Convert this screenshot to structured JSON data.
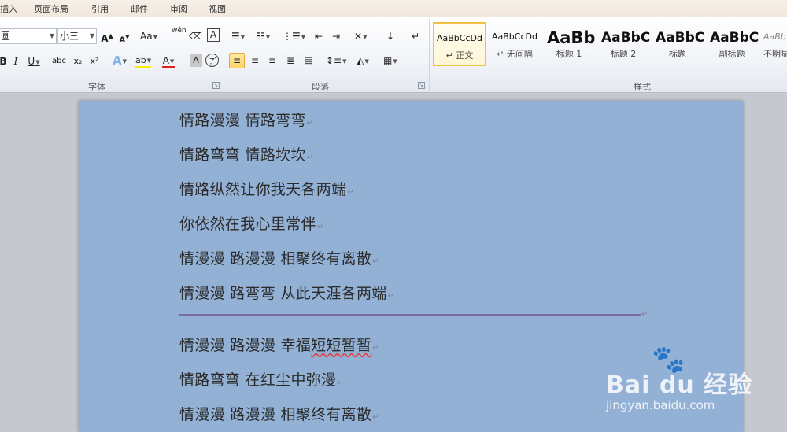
{
  "menu": {
    "tabs": [
      "插入",
      "页面布局",
      "引用",
      "邮件",
      "审阅",
      "视图"
    ]
  },
  "ribbon": {
    "font": {
      "font_name": "圆",
      "font_size": "小三",
      "grow_label": "A",
      "shrink_label": "A",
      "change_case": "Aa",
      "phonetic": "wén",
      "char_border": "A",
      "enclose": "字",
      "italic": "I",
      "underline": "U",
      "strike": "abc",
      "subscript": "x₂",
      "superscript": "x²",
      "text_effects": "A",
      "highlight": "ab",
      "font_color": "A",
      "shading": "A",
      "group_label": "字体"
    },
    "paragraph": {
      "group_label": "段落"
    },
    "styles": {
      "group_label": "样式",
      "items": [
        {
          "sample": "AaBbCcDd",
          "name": "↵ 正文"
        },
        {
          "sample": "AaBbCcDd",
          "name": "↵ 无间隔"
        },
        {
          "sample": "AaBb",
          "name": "标题 1"
        },
        {
          "sample": "AaBbC",
          "name": "标题 2"
        },
        {
          "sample": "AaBbC",
          "name": "标题"
        },
        {
          "sample": "AaBbC",
          "name": "副标题"
        },
        {
          "sample": "AaBb",
          "name": "不明显"
        }
      ]
    }
  },
  "document": {
    "lines_top": [
      "情路漫漫  情路弯弯",
      "情路弯弯  情路坎坎",
      "情路纵然让你我天各两端",
      "你依然在我心里常伴",
      "情漫漫  路漫漫  相聚终有离散",
      "情漫漫  路弯弯  从此天涯各两端"
    ],
    "line7_before": "情漫漫  路漫漫  幸福",
    "line7_marked": "短短暂暂",
    "lines_bottom": [
      "情路弯弯  在红尘中弥漫",
      "情漫漫  路漫漫  相聚终有离散"
    ],
    "para_mark": "↵"
  },
  "watermark": {
    "brand": "Bai  du 经验",
    "url": "jingyan.baidu.com"
  },
  "colors": {
    "page": "#92b1d5",
    "rule": "#7d6aa8"
  }
}
